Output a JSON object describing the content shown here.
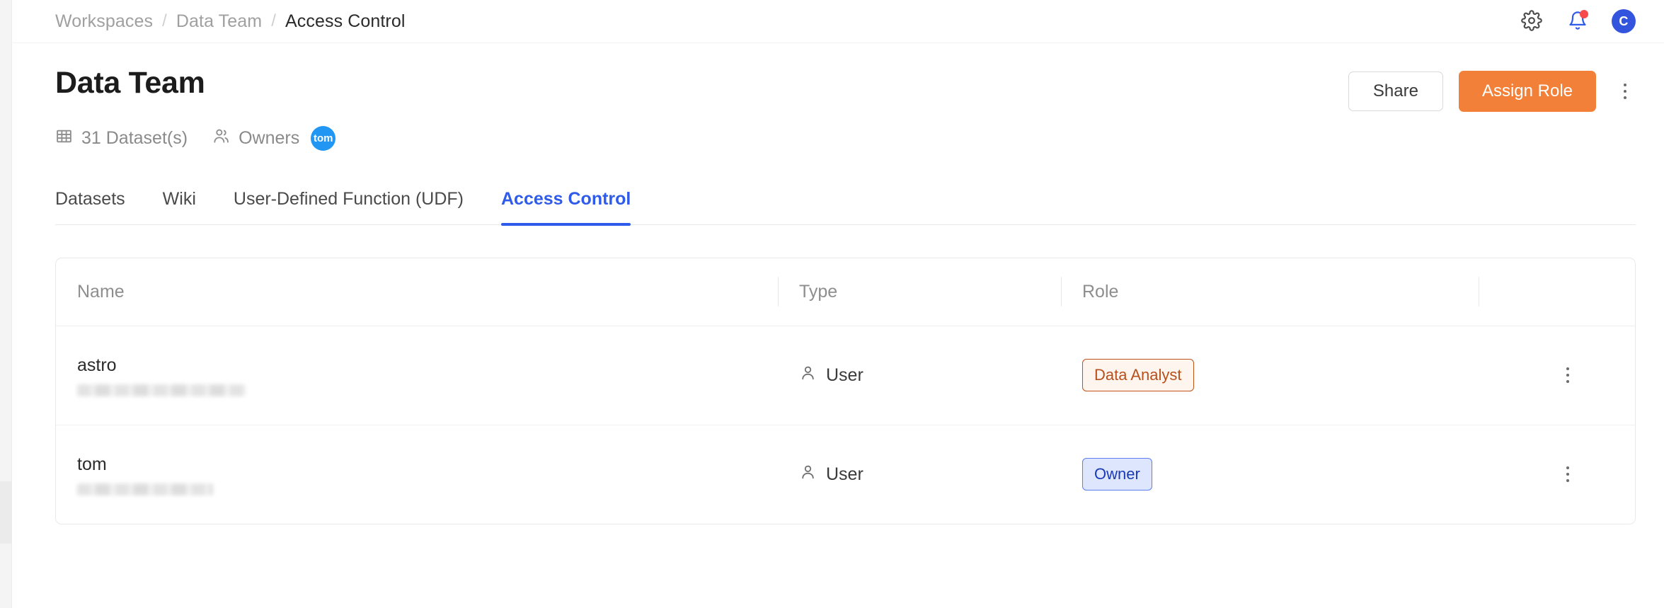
{
  "breadcrumb": {
    "items": [
      {
        "label": "Workspaces",
        "current": false
      },
      {
        "label": "Data Team",
        "current": false
      },
      {
        "label": "Access Control",
        "current": true
      }
    ],
    "separator": "/"
  },
  "topbar": {
    "settings_icon": "gear-icon",
    "notifications_icon": "bell-icon",
    "has_notification": true,
    "avatar_initial": "C",
    "avatar_color": "#3355dd",
    "notification_dot_color": "#f84a4a"
  },
  "header": {
    "title": "Data Team",
    "share_label": "Share",
    "assign_role_label": "Assign Role",
    "assign_role_color": "#f28038",
    "more_icon": "kebab-menu-icon"
  },
  "meta": {
    "dataset_icon": "table-grid-icon",
    "dataset_count_label": "31 Dataset(s)",
    "owners_icon": "users-icon",
    "owners_label": "Owners",
    "owner_avatar": "tom",
    "owner_avatar_color": "#2196f3"
  },
  "tabs": [
    {
      "label": "Datasets",
      "active": false
    },
    {
      "label": "Wiki",
      "active": false
    },
    {
      "label": "User-Defined Function (UDF)",
      "active": false
    },
    {
      "label": "Access Control",
      "active": true
    }
  ],
  "tab_active_color": "#2f5bea",
  "table": {
    "columns": [
      {
        "key": "name",
        "label": "Name"
      },
      {
        "key": "type",
        "label": "Type"
      },
      {
        "key": "role",
        "label": "Role"
      },
      {
        "key": "actions",
        "label": ""
      }
    ],
    "rows": [
      {
        "name": "astro",
        "email_redacted": true,
        "type": "User",
        "type_icon": "user-icon",
        "role": "Data Analyst",
        "role_style": "analyst",
        "actions_icon": "kebab-menu-icon"
      },
      {
        "name": "tom",
        "email_redacted": true,
        "type": "User",
        "type_icon": "user-icon",
        "role": "Owner",
        "role_style": "owner",
        "actions_icon": "kebab-menu-icon"
      }
    ]
  }
}
